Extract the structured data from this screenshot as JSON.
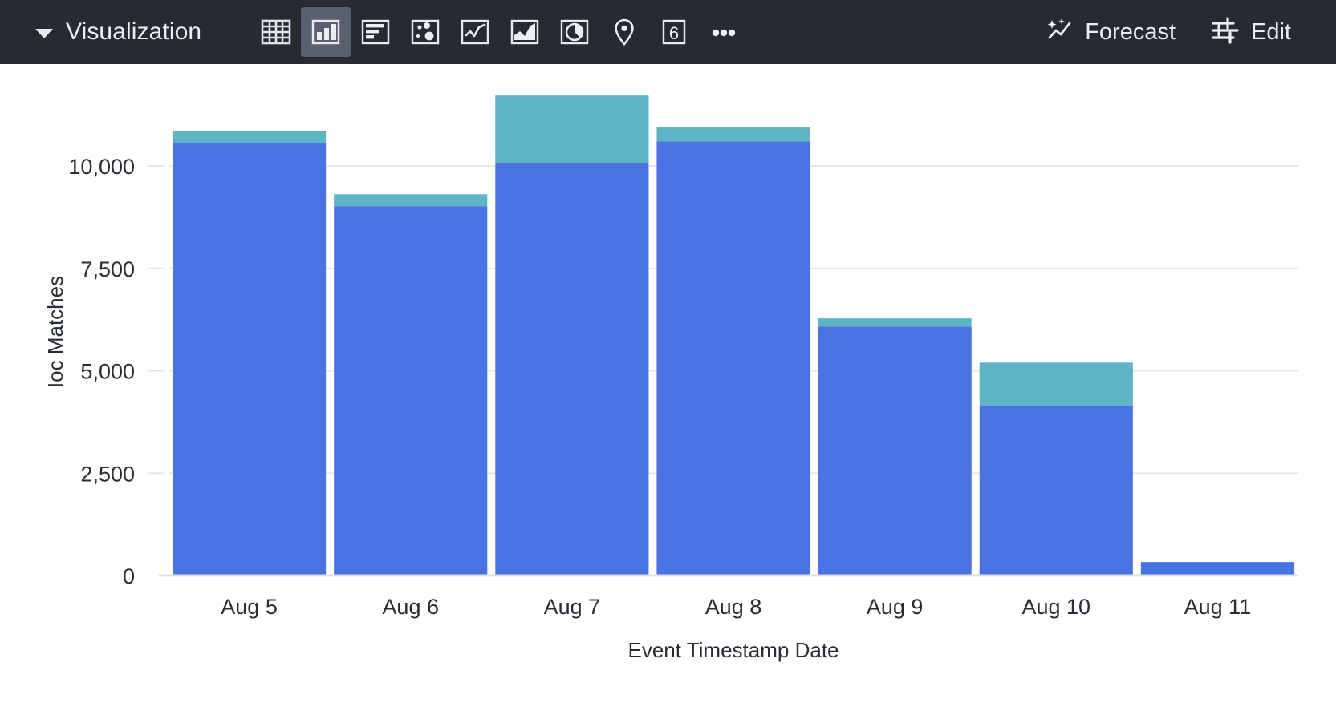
{
  "toolbar": {
    "menu_label": "Visualization",
    "caret_icon": "chevron-down-icon",
    "viz_icons": [
      {
        "name": "table-icon",
        "title": "Table",
        "selected": false
      },
      {
        "name": "column-chart-icon",
        "title": "Column Chart",
        "selected": true
      },
      {
        "name": "bar-chart-icon",
        "title": "Bar Chart",
        "selected": false
      },
      {
        "name": "bubble-chart-icon",
        "title": "Bubble Chart",
        "selected": false
      },
      {
        "name": "line-chart-icon",
        "title": "Line Chart",
        "selected": false
      },
      {
        "name": "area-chart-icon",
        "title": "Area Chart",
        "selected": false
      },
      {
        "name": "pie-chart-icon",
        "title": "Pie Chart",
        "selected": false
      },
      {
        "name": "map-pin-icon",
        "title": "Map",
        "selected": false
      },
      {
        "name": "single-value-icon",
        "title": "Single Value",
        "selected": false,
        "glyph": "6"
      },
      {
        "name": "more-options-icon",
        "title": "More",
        "selected": false
      }
    ],
    "forecast": {
      "label": "Forecast",
      "icon": "sparkle-trend-icon"
    },
    "edit": {
      "label": "Edit",
      "icon": "sliders-icon"
    },
    "colors": {
      "bar_background": "#252a33",
      "text": "#eceef1",
      "selected_tile": "#5a6070"
    }
  },
  "chart_data": {
    "type": "bar",
    "stacked": true,
    "title": "",
    "xlabel": "Event Timestamp Date",
    "ylabel": "Ioc Matches",
    "categories": [
      "Aug 5",
      "Aug 6",
      "Aug 7",
      "Aug 8",
      "Aug 9",
      "Aug 10",
      "Aug 11"
    ],
    "series": [
      {
        "name": "series-1",
        "color": "#4a72e0",
        "values": [
          10550,
          9020,
          10080,
          10600,
          6080,
          4140,
          330
        ]
      },
      {
        "name": "series-2",
        "color": "#5cb4c5",
        "values": [
          310,
          290,
          1640,
          340,
          200,
          1060,
          0
        ]
      }
    ],
    "totals": [
      10860,
      9310,
      11720,
      10940,
      6280,
      5200,
      330
    ],
    "ylim": [
      0,
      11900
    ],
    "yticks": [
      0,
      2500,
      5000,
      7500,
      10000
    ],
    "ytick_labels": [
      "0",
      "2,500",
      "5,000",
      "7,500",
      "10,000"
    ],
    "grid": true,
    "legend": "none"
  }
}
